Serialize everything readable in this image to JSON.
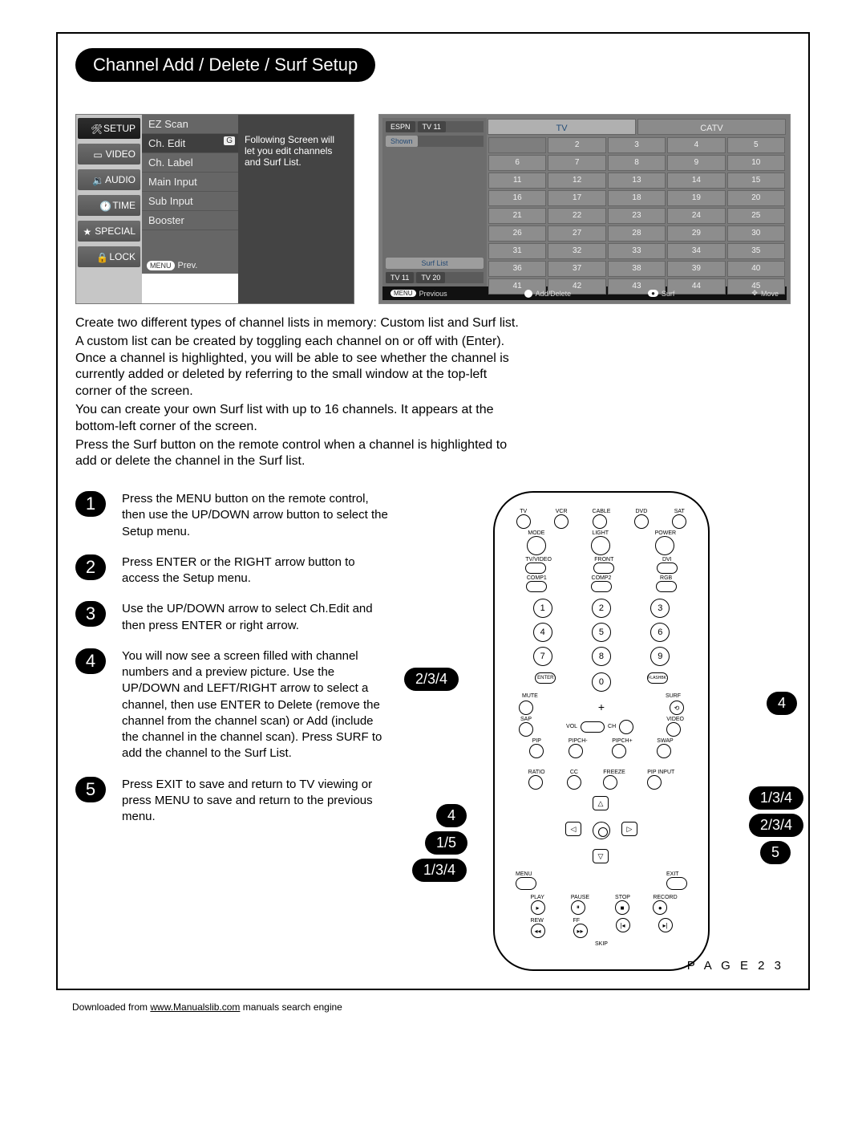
{
  "title": "Channel Add / Delete / Surf Setup",
  "osd": {
    "tabs": [
      "SETUP",
      "VIDEO",
      "AUDIO",
      "TIME",
      "SPECIAL",
      "LOCK"
    ],
    "items": [
      "EZ Scan",
      "Ch. Edit",
      "Ch. Label",
      "Main Input",
      "Sub Input",
      "Booster"
    ],
    "g_badge": "G",
    "prev_pill": "MENU",
    "prev_text": "Prev.",
    "desc": "Following Screen will let you edit channels and Surf List."
  },
  "scr": {
    "left_top": [
      "ESPN",
      "TV 11"
    ],
    "left_top_sel": "Shown",
    "surf_label": "Surf List",
    "surf": [
      "TV 11",
      "TV 20"
    ],
    "headers": [
      "TV",
      "CATV"
    ],
    "channels": [
      "",
      "2",
      "3",
      "4",
      "5",
      "6",
      "7",
      "8",
      "9",
      "10",
      "11",
      "12",
      "13",
      "14",
      "15",
      "16",
      "17",
      "18",
      "19",
      "20",
      "21",
      "22",
      "23",
      "24",
      "25",
      "26",
      "27",
      "28",
      "29",
      "30",
      "31",
      "32",
      "33",
      "34",
      "35",
      "36",
      "37",
      "38",
      "39",
      "40",
      "41",
      "42",
      "43",
      "44",
      "45"
    ],
    "bottom": {
      "menu_pill": "MENU",
      "previous": "Previous",
      "add": "Add/Delete",
      "surf_pill": "Surf",
      "surf": "Surf",
      "move": "Move"
    }
  },
  "body": "Create two different types of channel lists in memory: Custom list and Surf list.\nA custom list can be created by toggling each channel on or off with (Enter). Once a channel is highlighted, you will be able to see whether the channel is currently added or deleted by referring to the small window at the top-left corner of the screen.\nYou can create your own Surf list with up to 16 channels. It appears at the bottom-left corner of the screen.\nPress the Surf button on the remote control when a channel is highlighted to add or delete the channel in the Surf list.",
  "steps": [
    {
      "n": "1",
      "t": "Press the MENU button on the remote control, then use the UP/DOWN arrow button to select the Setup menu."
    },
    {
      "n": "2",
      "t": "Press ENTER or the RIGHT arrow button to access the Setup menu."
    },
    {
      "n": "3",
      "t": "Use the UP/DOWN arrow to select Ch.Edit and then press ENTER or right arrow."
    },
    {
      "n": "4",
      "t": "You will now see a screen filled with channel numbers and a preview picture. Use the UP/DOWN and LEFT/RIGHT arrow to select a channel, then use ENTER to Delete (remove the channel from the channel scan) or Add (include the channel in the channel scan). Press SURF to add the channel to the Surf List."
    },
    {
      "n": "5",
      "t": "Press EXIT to save and return to TV viewing or press MENU to save and return to the previous menu."
    }
  ],
  "remote": {
    "top_labels": [
      "TV",
      "VCR",
      "CABLE",
      "DVD",
      "SAT"
    ],
    "row2": [
      "MODE",
      "LIGHT",
      "POWER"
    ],
    "row3": [
      "TV/VIDEO",
      "FRONT",
      "DVI"
    ],
    "row4": [
      "COMP1",
      "COMP2",
      "RGB"
    ],
    "nums": [
      "1",
      "2",
      "3",
      "4",
      "5",
      "6",
      "7",
      "8",
      "9"
    ],
    "enter": "ENTER",
    "zero": "0",
    "flash": "FLASHBK",
    "mute_row": [
      "MUTE",
      "SURF"
    ],
    "sap_row": [
      "SAP",
      "",
      "VIDEO"
    ],
    "vol": "VOL",
    "ch": "CH",
    "pip_row": [
      "PIP",
      "PIPCH-",
      "PIPCH+",
      "SWAP"
    ],
    "ratio_row": [
      "RATIO",
      "CC",
      "FREEZE",
      "PIP INPUT"
    ],
    "menu": "MENU",
    "exit": "EXIT",
    "trans": [
      "PLAY",
      "PAUSE",
      "STOP",
      "RECORD"
    ],
    "trans2": [
      "REW",
      "FF",
      "",
      ""
    ],
    "skip": "SKIP"
  },
  "callouts": {
    "left_234": "2/3/4",
    "left_4": "4",
    "left_15": "1/5",
    "left_134": "1/3/4",
    "right_4": "4",
    "right_134": "1/3/4",
    "right_234": "2/3/4",
    "right_5": "5"
  },
  "page_num": "P A G E  2 3",
  "footer": {
    "pre": "Downloaded from ",
    "link": "www.Manualslib.com",
    "post": " manuals search engine"
  }
}
